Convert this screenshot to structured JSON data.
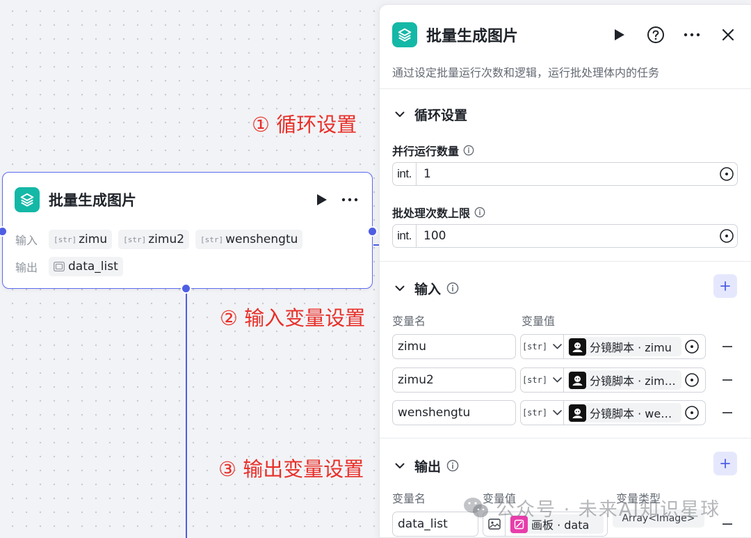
{
  "node": {
    "title": "批量生成图片",
    "input_label": "输入",
    "output_label": "输出",
    "inputs": [
      {
        "type": "[str]",
        "name": "zimu"
      },
      {
        "type": "[str]",
        "name": "zimu2"
      },
      {
        "type": "[str]",
        "name": "wenshengtu"
      }
    ],
    "outputs": [
      {
        "type": "[img]",
        "name": "data_list"
      }
    ]
  },
  "annotations": {
    "a1": "① 循环设置",
    "a2": "② 输入变量设置",
    "a3": "③ 输出变量设置"
  },
  "panel": {
    "title": "批量生成图片",
    "description": "通过设定批量运行次数和逻辑，运行批处理体内的任务",
    "loop": {
      "title": "循环设置",
      "parallel_label": "并行运行数量",
      "parallel_prefix": "int.",
      "parallel_value": "1",
      "batch_label": "批处理次数上限",
      "batch_prefix": "int.",
      "batch_value": "100"
    },
    "input": {
      "title": "输入",
      "col_name": "变量名",
      "col_value": "变量值",
      "rows": [
        {
          "name": "zimu",
          "type": "[str]",
          "ref": "分镜脚本 · zimu"
        },
        {
          "name": "zimu2",
          "type": "[str]",
          "ref": "分镜脚本 · zim…"
        },
        {
          "name": "wenshengtu",
          "type": "[str]",
          "ref": "分镜脚本 · we…"
        }
      ]
    },
    "output": {
      "title": "输出",
      "col_name": "变量名",
      "col_value": "变量值",
      "col_type": "变量类型",
      "rows": [
        {
          "name": "data_list",
          "ref": "画板 · data",
          "type": "Array<Image>"
        }
      ]
    }
  },
  "watermark": "公众号 · 未来AI知识星球",
  "colors": {
    "accent": "#4e5ee4",
    "app_icon": "#14b8a6",
    "annotation": "#e8302a",
    "add_button_bg": "#e5e8fd",
    "canvas_ref_icon": "#e83dab"
  }
}
